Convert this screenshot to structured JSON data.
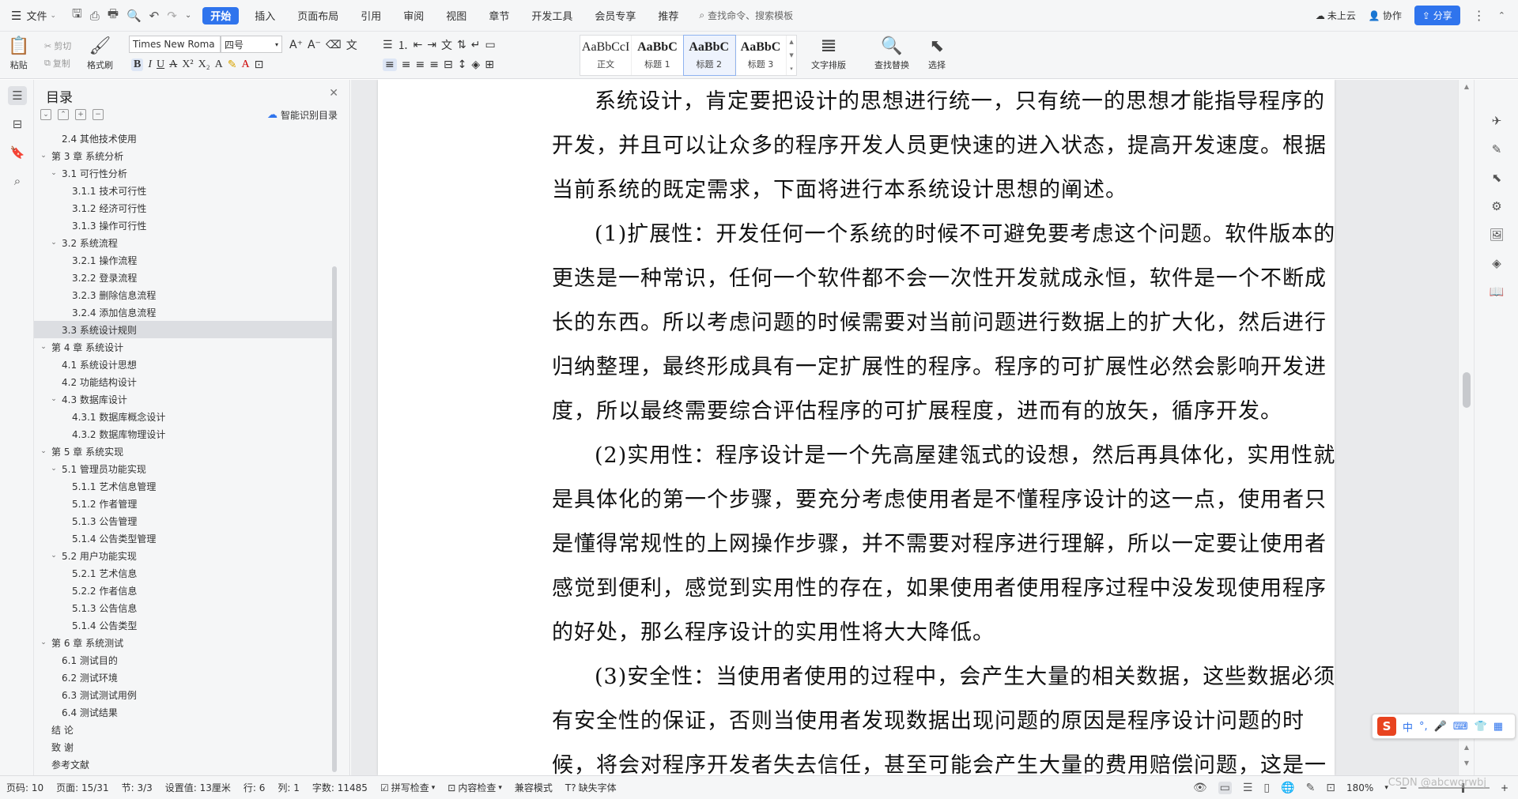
{
  "menubar": {
    "file_label": "文件",
    "tabs": [
      {
        "label": "开始",
        "active": true
      },
      {
        "label": "插入"
      },
      {
        "label": "页面布局"
      },
      {
        "label": "引用"
      },
      {
        "label": "审阅"
      },
      {
        "label": "视图"
      },
      {
        "label": "章节"
      },
      {
        "label": "开发工具"
      },
      {
        "label": "会员专享"
      },
      {
        "label": "推荐"
      }
    ],
    "search_label": "查找命令、搜索模板",
    "not_uploaded": "未上云",
    "collab": "协作",
    "share": "分享",
    "accent": "#2f74ed"
  },
  "ribbon": {
    "paste": "粘贴",
    "cut": "剪切",
    "copy": "复制",
    "format_painter": "格式刷",
    "font_name": "Times New Roma",
    "font_size": "四号",
    "styles": [
      {
        "preview": "AaBbCcI",
        "label": "正文",
        "bold": false
      },
      {
        "preview": "AaBbC",
        "label": "标题 1",
        "bold": true
      },
      {
        "preview": "AaBbC",
        "label": "标题 2",
        "bold": true,
        "active": true
      },
      {
        "preview": "AaBbC",
        "label": "标题 3",
        "bold": true
      }
    ],
    "text_layout": "文字排版",
    "find_replace": "查找替换",
    "select": "选择"
  },
  "toc": {
    "title": "目录",
    "smart_label": "智能识别目录",
    "items": [
      {
        "level": 2,
        "label": "2.4  其他技术使用",
        "arrow": ""
      },
      {
        "level": 1,
        "label": "第 3 章  系统分析",
        "arrow": "⌄"
      },
      {
        "level": 2,
        "label": "3.1  可行性分析",
        "arrow": "⌄"
      },
      {
        "level": 3,
        "label": "3.1.1  技术可行性",
        "arrow": ""
      },
      {
        "level": 3,
        "label": "3.1.2  经济可行性",
        "arrow": ""
      },
      {
        "level": 3,
        "label": "3.1.3  操作可行性",
        "arrow": ""
      },
      {
        "level": 2,
        "label": "3.2  系统流程",
        "arrow": "⌄"
      },
      {
        "level": 3,
        "label": "3.2.1  操作流程",
        "arrow": ""
      },
      {
        "level": 3,
        "label": "3.2.2  登录流程",
        "arrow": ""
      },
      {
        "level": 3,
        "label": "3.2.3  删除信息流程",
        "arrow": ""
      },
      {
        "level": 3,
        "label": "3.2.4  添加信息流程",
        "arrow": ""
      },
      {
        "level": 2,
        "label": "3.3  系统设计规则",
        "arrow": "",
        "selected": true
      },
      {
        "level": 1,
        "label": "第 4 章  系统设计",
        "arrow": "⌄"
      },
      {
        "level": 2,
        "label": "4.1  系统设计思想",
        "arrow": ""
      },
      {
        "level": 2,
        "label": "4.2  功能结构设计",
        "arrow": ""
      },
      {
        "level": 2,
        "label": "4.3  数据库设计",
        "arrow": "⌄"
      },
      {
        "level": 3,
        "label": "4.3.1  数据库概念设计",
        "arrow": ""
      },
      {
        "level": 3,
        "label": "4.3.2  数据库物理设计",
        "arrow": ""
      },
      {
        "level": 1,
        "label": "第 5 章  系统实现",
        "arrow": "⌄"
      },
      {
        "level": 2,
        "label": "5.1  管理员功能实现",
        "arrow": "⌄"
      },
      {
        "level": 3,
        "label": "5.1.1  艺术信息管理",
        "arrow": ""
      },
      {
        "level": 3,
        "label": "5.1.2  作者管理",
        "arrow": ""
      },
      {
        "level": 3,
        "label": "5.1.3  公告管理",
        "arrow": ""
      },
      {
        "level": 3,
        "label": "5.1.4  公告类型管理",
        "arrow": ""
      },
      {
        "level": 2,
        "label": "5.2  用户功能实现",
        "arrow": "⌄"
      },
      {
        "level": 3,
        "label": "5.2.1  艺术信息",
        "arrow": ""
      },
      {
        "level": 3,
        "label": "5.2.2  作者信息",
        "arrow": ""
      },
      {
        "level": 3,
        "label": "5.1.3  公告信息",
        "arrow": ""
      },
      {
        "level": 3,
        "label": "5.1.4  公告类型",
        "arrow": ""
      },
      {
        "level": 1,
        "label": "第 6 章  系统测试",
        "arrow": "⌄"
      },
      {
        "level": 2,
        "label": "6.1  测试目的",
        "arrow": ""
      },
      {
        "level": 2,
        "label": "6.2  测试环境",
        "arrow": ""
      },
      {
        "level": 2,
        "label": "6.3  测试测试用例",
        "arrow": ""
      },
      {
        "level": 2,
        "label": "6.4  测试结果",
        "arrow": ""
      },
      {
        "level": 1,
        "label": "结    论",
        "arrow": ""
      },
      {
        "level": 1,
        "label": "致    谢",
        "arrow": ""
      },
      {
        "level": 1,
        "label": "参考文献",
        "arrow": ""
      }
    ]
  },
  "document": {
    "paragraphs": [
      "系统设计，肯定要把设计的思想进行统一，只有统一的思想才能指导程序的开发，并且可以让众多的程序开发人员更快速的进入状态，提高开发速度。根据当前系统的既定需求，下面将进行本系统设计思想的阐述。",
      "(1)扩展性：开发任何一个系统的时候不可避免要考虑这个问题。软件版本的更迭是一种常识，任何一个软件都不会一次性开发就成永恒，软件是一个不断成长的东西。所以考虑问题的时候需要对当前问题进行数据上的扩大化，然后进行归纳整理，最终形成具有一定扩展性的程序。程序的可扩展性必然会影响开发进度，所以最终需要综合评估程序的可扩展程度，进而有的放矢，循序开发。",
      "(2)实用性：程序设计是一个先高屋建瓴式的设想，然后再具体化，实用性就是具体化的第一个步骤，要充分考虑使用者是不懂程序设计的这一点，使用者只是懂得常规性的上网操作步骤，并不需要对程序进行理解，所以一定要让使用者感觉到便利，感觉到实用性的存在，如果使用者使用程序过程中没发现使用程序的好处，那么程序设计的实用性将大大降低。",
      "(3)安全性：当使用者使用的过程中，会产生大量的相关数据，这些数据必须有安全性的保证，否则当使用者发现数据出现问题的原因是程序设计问题的时候，将会对程序开发者失去信任，甚至可能会产生大量的费用赔偿问题，这是一"
    ]
  },
  "ime": {
    "logo": "S",
    "mode": "中"
  },
  "statusbar": {
    "page_num": "页码: 10",
    "pages": "页面: 15/31",
    "section": "节: 3/3",
    "setting": "设置值: 13厘米",
    "row": "行: 6",
    "col": "列: 1",
    "word_count": "字数: 11485",
    "spell_check": "拼写检查",
    "content_check": "内容检查",
    "compat_mode": "兼容模式",
    "missing_font": "缺失字体",
    "zoom": "180%",
    "watermark": "CSDN @abcwqrwbj"
  }
}
